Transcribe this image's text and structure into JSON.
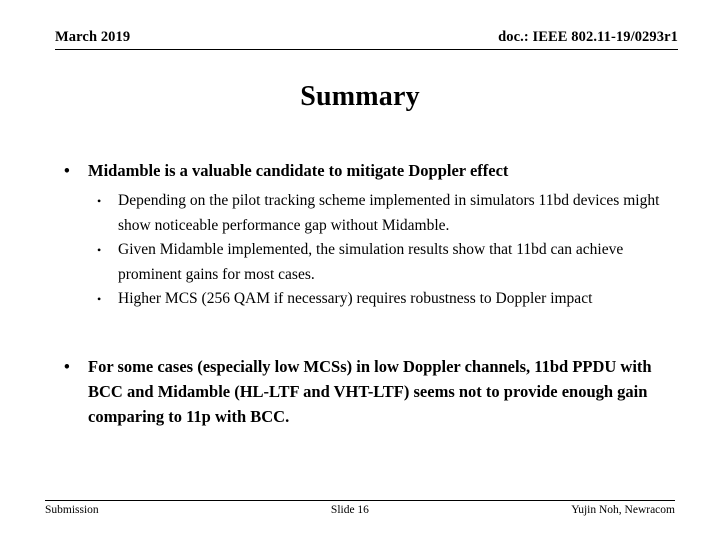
{
  "header": {
    "date": "March 2019",
    "doc_id": "doc.: IEEE 802.11-19/0293r1"
  },
  "title": "Summary",
  "content": {
    "bullets": [
      {
        "text": "Midamble is a valuable candidate to mitigate Doppler effect",
        "marker": "•",
        "sub_bullets": [
          {
            "marker": "•",
            "text": "Depending on the pilot tracking scheme implemented in simulators 11bd devices might show noticeable performance gap without Midamble."
          },
          {
            "marker": "•",
            "text": "Given Midamble implemented, the simulation results show that 11bd can achieve prominent gains for most cases."
          },
          {
            "marker": "•",
            "text": "Higher MCS (256 QAM if necessary) requires robustness to Doppler impact"
          }
        ]
      },
      {
        "text": "For some cases (especially low MCSs) in low Doppler channels, 11bd PPDU with BCC and Midamble (HL-LTF and VHT-LTF) seems not to provide enough gain comparing to 11p with BCC.",
        "marker": "•",
        "sub_bullets": []
      }
    ]
  },
  "footer": {
    "left": "Submission",
    "center": "Slide 16",
    "right": "Yujin Noh, Newracom"
  }
}
